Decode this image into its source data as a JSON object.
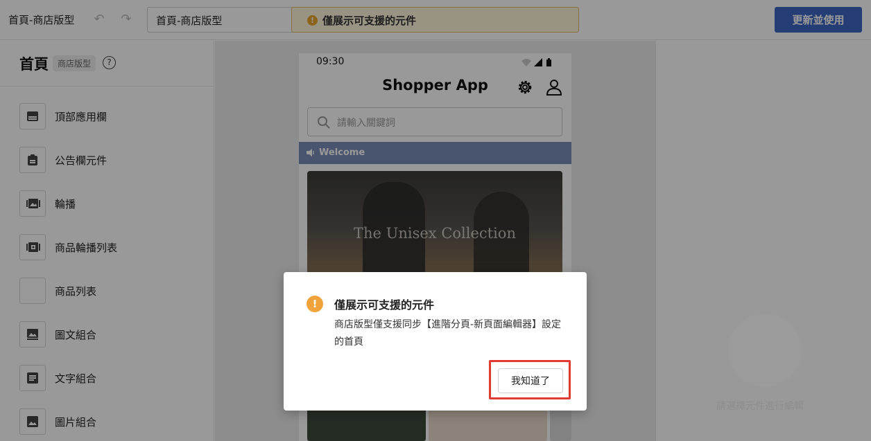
{
  "topbar": {
    "page_name": "首頁-商店版型",
    "page_select_value": "首頁-商店版型",
    "warning_banner": "僅展示可支援的元件",
    "publish_label": "更新並使用"
  },
  "sidebar": {
    "title": "首頁",
    "badge": "商店版型",
    "help": "?",
    "items": [
      {
        "label": "頂部應用欄",
        "icon": "app-bar-icon"
      },
      {
        "label": "公告欄元件",
        "icon": "announcement-icon"
      },
      {
        "label": "輪播",
        "icon": "carousel-icon"
      },
      {
        "label": "商品輪播列表",
        "icon": "product-carousel-icon"
      },
      {
        "label": "商品列表",
        "icon": "product-list-icon"
      },
      {
        "label": "圖文組合",
        "icon": "image-text-icon"
      },
      {
        "label": "文字組合",
        "icon": "text-block-icon"
      },
      {
        "label": "圖片組合",
        "icon": "image-group-icon"
      }
    ]
  },
  "preview": {
    "status_time": "09:30",
    "app_title": "Shopper App",
    "search_placeholder": "請輸入關鍵詞",
    "announcement": "Welcome",
    "banner_text": "The Unisex Collection"
  },
  "right_panel": {
    "empty_text": "請選擇元件進行編輯"
  },
  "dialog": {
    "title": "僅展示可支援的元件",
    "body": "商店版型僅支援同步【進階分頁-新頁面編輯器】設定的首頁",
    "confirm_label": "我知道了"
  },
  "colors": {
    "primary": "#3e66c3",
    "warning": "#f0a33a",
    "announcement_bg": "#7a8db8",
    "focus_outline": "#e03a31"
  }
}
